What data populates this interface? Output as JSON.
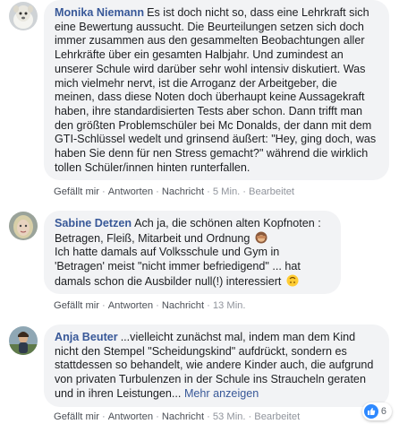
{
  "comments": [
    {
      "author": "Monika Niemann",
      "text": "Es ist doch nicht so, dass eine Lehrkraft sich eine Bewertung aussucht. Die Beurteilungen setzen sich doch immer zusammen aus den gesammelten Beobachtungen aller Lehrkräfte über ein gesamten Halbjahr. Und zumindest an unserer Schule wird darüber sehr wohl intensiv diskutiert. Was mich vielmehr nervt, ist die Arroganz der Arbeitgeber, die meinen, dass diese Noten doch überhaupt keine Aussagekraft haben, ihre standardisierten Tests aber schon. Dann trifft man den größten Problemschüler bei Mc Donalds, der dann mit dem GTI-Schlüssel wedelt und grinsend äußert: \"Hey, ging doch, was haben Sie denn für nen Stress gemacht?\" während die wirklich tollen Schüler/innen hinten runterfallen.",
      "actions": {
        "like": "Gefällt mir",
        "reply": "Antworten",
        "message": "Nachricht",
        "time": "5 Min.",
        "edited": "Bearbeitet"
      }
    },
    {
      "author": "Sabine Detzen",
      "text": "Ach ja, die schönen alten Kopfnoten : Betragen, Fleiß, Mitarbeit und Ordnung",
      "text2": "Ich hatte damals auf Volksschule und Gym in 'Betragen' meist \"nicht immer befriedigend\" ... hat damals schon die Ausbilder null(!) interessiert",
      "actions": {
        "like": "Gefällt mir",
        "reply": "Antworten",
        "message": "Nachricht",
        "time": "13 Min."
      }
    },
    {
      "author": "Anja Beuter",
      "text": "...vielleicht zunächst mal, indem man dem Kind nicht den Stempel \"Scheidungskind\" aufdrückt, sondern es stattdessen so behandelt, wie andere Kinder auch, die aufgrund von privaten Turbulenzen in der Schule ins Straucheln geraten und in ihren Leistungen...",
      "more": "Mehr anzeigen",
      "actions": {
        "like": "Gefällt mir",
        "reply": "Antworten",
        "message": "Nachricht",
        "time": "53 Min.",
        "edited": "Bearbeitet"
      },
      "reactions": {
        "count": "6"
      }
    }
  ],
  "icons": {
    "emoji_monkey": "see-no-evil-monkey-icon",
    "emoji_upside": "upside-down-face-icon",
    "like": "like-icon"
  },
  "colors": {
    "name": "#385898",
    "bubble": "#f2f3f5",
    "like_blue": "#2e89ff"
  }
}
